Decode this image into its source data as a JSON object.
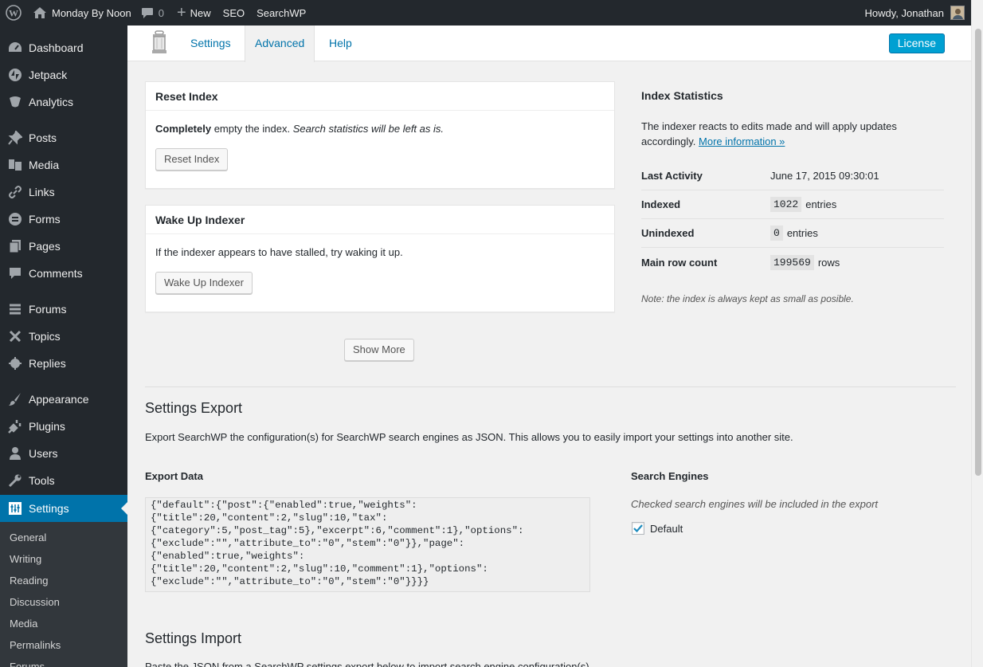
{
  "adminbar": {
    "site_name": "Monday By Noon",
    "comments_count": "0",
    "new_label": "New",
    "seo_label": "SEO",
    "searchwp_label": "SearchWP",
    "greeting": "Howdy, Jonathan"
  },
  "sidebar": {
    "items": [
      {
        "label": "Dashboard",
        "icon": "dashboard-icon"
      },
      {
        "label": "Jetpack",
        "icon": "jetpack-icon"
      },
      {
        "label": "Analytics",
        "icon": "analytics-icon"
      },
      {
        "label": "Posts",
        "icon": "pin-icon"
      },
      {
        "label": "Media",
        "icon": "media-icon"
      },
      {
        "label": "Links",
        "icon": "link-icon"
      },
      {
        "label": "Forms",
        "icon": "forms-icon"
      },
      {
        "label": "Pages",
        "icon": "pages-icon"
      },
      {
        "label": "Comments",
        "icon": "comment-icon"
      },
      {
        "label": "Forums",
        "icon": "forums-icon"
      },
      {
        "label": "Topics",
        "icon": "topics-icon"
      },
      {
        "label": "Replies",
        "icon": "replies-icon"
      },
      {
        "label": "Appearance",
        "icon": "brush-icon"
      },
      {
        "label": "Plugins",
        "icon": "plugin-icon"
      },
      {
        "label": "Users",
        "icon": "user-icon"
      },
      {
        "label": "Tools",
        "icon": "wrench-icon"
      },
      {
        "label": "Settings",
        "icon": "settings-icon",
        "active": true
      }
    ],
    "submenu": [
      "General",
      "Writing",
      "Reading",
      "Discussion",
      "Media",
      "Permalinks",
      "Forums"
    ]
  },
  "nav": {
    "tabs": [
      "Settings",
      "Advanced",
      "Help"
    ],
    "active_tab": "Advanced",
    "license_label": "License"
  },
  "reset_index": {
    "title": "Reset Index",
    "desc_bold": "Completely",
    "desc_plain": " empty the index. ",
    "desc_italic": "Search statistics will be left as is.",
    "button": "Reset Index"
  },
  "wake_up": {
    "title": "Wake Up Indexer",
    "desc": "If the indexer appears to have stalled, try waking it up.",
    "button": "Wake Up Indexer"
  },
  "show_more_label": "Show More",
  "stats": {
    "title": "Index Statistics",
    "desc": "The indexer reacts to edits made and will apply updates accordingly.",
    "link": "More information »",
    "last_activity_label": "Last Activity",
    "last_activity_value": "June 17, 2015 09:30:01",
    "indexed_label": "Indexed",
    "indexed_value": "1022",
    "indexed_unit": "entries",
    "unindexed_label": "Unindexed",
    "unindexed_value": "0",
    "unindexed_unit": "entries",
    "rowcount_label": "Main row count",
    "rowcount_value": "199569",
    "rowcount_unit": "rows",
    "note": "Note: the index is always kept as small as posible."
  },
  "export": {
    "title": "Settings Export",
    "desc": "Export SearchWP the configuration(s) for SearchWP search engines as JSON. This allows you to easily import your settings into another site.",
    "data_label": "Export Data",
    "data_text": "{\"default\":{\"post\":{\"enabled\":true,\"weights\":\n{\"title\":20,\"content\":2,\"slug\":10,\"tax\":\n{\"category\":5,\"post_tag\":5},\"excerpt\":6,\"comment\":1},\"options\":\n{\"exclude\":\"\",\"attribute_to\":\"0\",\"stem\":\"0\"}},\"page\":\n{\"enabled\":true,\"weights\":\n{\"title\":20,\"content\":2,\"slug\":10,\"comment\":1},\"options\":\n{\"exclude\":\"\",\"attribute_to\":\"0\",\"stem\":\"0\"}}}}",
    "engines_label": "Search Engines",
    "engines_note": "Checked search engines will be included in the export",
    "engine_default": "Default",
    "engine_default_checked": true
  },
  "import": {
    "title": "Settings Import",
    "desc": "Paste the JSON from a SearchWP settings export below to import search engine configuration(s)."
  },
  "colors": {
    "adminbar_bg": "#23282d",
    "active_menu": "#0073aa",
    "license_btn": "#00a0d2",
    "link": "#0073aa"
  }
}
